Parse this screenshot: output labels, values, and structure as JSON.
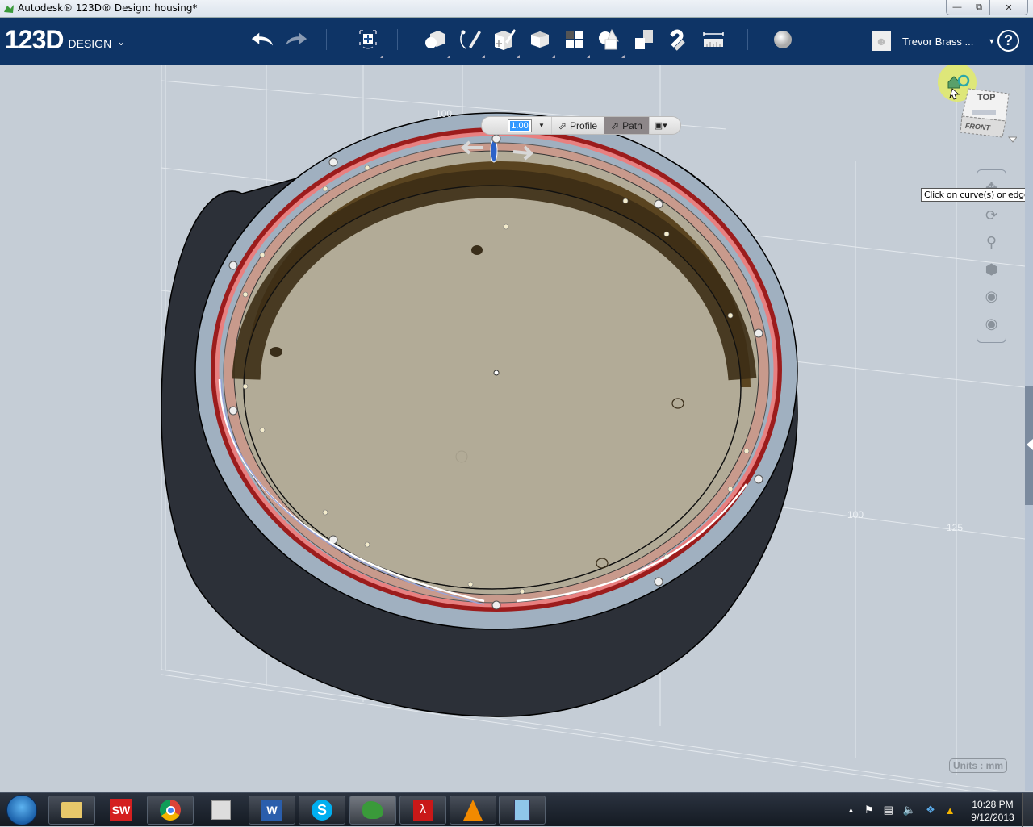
{
  "window": {
    "title": "Autodesk® 123D® Design: housing*",
    "controls": {
      "minimize": "—",
      "restore": "⧉",
      "close": "✕"
    }
  },
  "toolbar": {
    "logo_main": "123D",
    "logo_sub": "DESIGN",
    "logo_menu_icon": "chevron-down-icon",
    "tools": [
      {
        "name": "undo",
        "icon": "undo-arrow-icon"
      },
      {
        "name": "redo",
        "icon": "redo-arrow-icon"
      },
      {
        "name": "transform",
        "icon": "transform-move-icon",
        "has_submenu": true
      },
      {
        "name": "primitives",
        "icon": "primitives-icon",
        "has_submenu": true
      },
      {
        "name": "sketch",
        "icon": "sketch-pencil-icon",
        "has_submenu": true
      },
      {
        "name": "construct",
        "icon": "construct-icon",
        "has_submenu": true
      },
      {
        "name": "modify",
        "icon": "modify-icon",
        "has_submenu": true
      },
      {
        "name": "pattern",
        "icon": "pattern-grid-icon",
        "has_submenu": true
      },
      {
        "name": "grouping",
        "icon": "grouping-shapes-icon",
        "has_submenu": true
      },
      {
        "name": "combine",
        "icon": "combine-blocks-icon"
      },
      {
        "name": "snap",
        "icon": "snap-magnet-icon"
      },
      {
        "name": "measure",
        "icon": "measure-ruler-icon"
      },
      {
        "name": "material",
        "icon": "material-sphere-icon"
      }
    ],
    "user_name": "Trevor Brass ...",
    "help": "?"
  },
  "mini_toolbar": {
    "value": "1.00",
    "profile_label": "Profile",
    "path_label": "Path",
    "active_mode": "Path"
  },
  "viewcube": {
    "top_label": "TOP",
    "front_label": "FRONT"
  },
  "tooltip": "Click on curve(s) or edge(s)",
  "navbar": [
    {
      "name": "pan",
      "icon": "pan-icon"
    },
    {
      "name": "orbit",
      "icon": "orbit-icon"
    },
    {
      "name": "zoom",
      "icon": "zoom-icon"
    },
    {
      "name": "fit",
      "icon": "fit-view-icon"
    },
    {
      "name": "view-mode",
      "icon": "view-mode-icon"
    },
    {
      "name": "visibility",
      "icon": "eye-icon"
    }
  ],
  "grid_labels": [
    "100",
    "100",
    "125"
  ],
  "units_label": "Units : mm",
  "taskbar": {
    "apps": [
      {
        "name": "file-explorer",
        "icon": "folder-icon"
      },
      {
        "name": "solidworks",
        "icon": "solidworks-icon"
      },
      {
        "name": "chrome",
        "icon": "chrome-icon"
      },
      {
        "name": "screen-recorder",
        "icon": "recorder-icon"
      },
      {
        "name": "word",
        "icon": "word-icon"
      },
      {
        "name": "skype",
        "icon": "skype-icon"
      },
      {
        "name": "123d-design",
        "icon": "123d-icon",
        "active": true
      },
      {
        "name": "acrobat",
        "icon": "acrobat-icon"
      },
      {
        "name": "vlc",
        "icon": "vlc-cone-icon"
      },
      {
        "name": "calculator",
        "icon": "calculator-icon"
      }
    ],
    "tray": [
      "show-hidden-icon",
      "action-center-flag-icon",
      "network-icon",
      "volume-icon",
      "dropbox-icon",
      "google-drive-icon"
    ],
    "time": "10:28 PM",
    "date": "9/12/2013"
  }
}
